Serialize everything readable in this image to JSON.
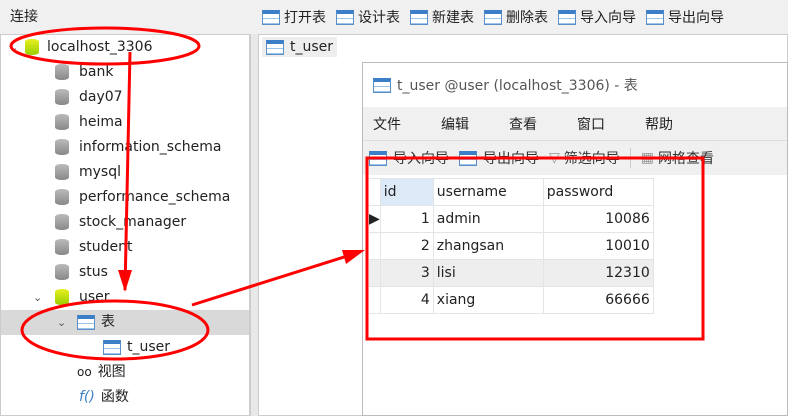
{
  "left": {
    "header": "连接",
    "connection": "localhost_3306",
    "databases": [
      "bank",
      "day07",
      "heima",
      "information_schema",
      "mysql",
      "performance_schema",
      "stock_manager",
      "student",
      "stus"
    ],
    "open_db": "user",
    "tables_node": "表",
    "table": "t_user",
    "views": "视图",
    "functions": "函数"
  },
  "toolbar": [
    "打开表",
    "设计表",
    "新建表",
    "删除表",
    "导入向导",
    "导出向导"
  ],
  "tab": "t_user",
  "window": {
    "title": "t_user @user (localhost_3306) - 表",
    "menu": [
      "文件",
      "编辑",
      "查看",
      "窗口",
      "帮助"
    ],
    "tools": [
      "导入向导",
      "导出向导",
      "筛选向导",
      "网格查看"
    ],
    "columns": [
      "id",
      "username",
      "password"
    ],
    "rows": [
      [
        "1",
        "admin",
        "10086"
      ],
      [
        "2",
        "zhangsan",
        "10010"
      ],
      [
        "3",
        "lisi",
        "12310"
      ],
      [
        "4",
        "xiang",
        "66666"
      ]
    ]
  },
  "annotation_color": "#ff0000"
}
